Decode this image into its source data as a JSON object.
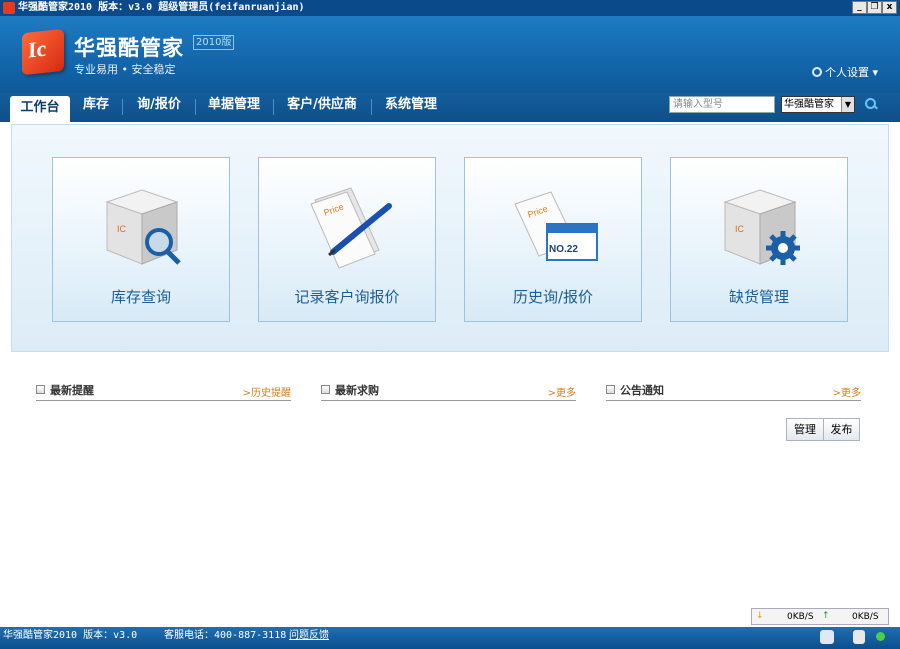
{
  "window": {
    "title": "华强酷管家2010 版本：v3.0  超级管理员(feifanruanjian)",
    "minimize": "_",
    "restore": "❐",
    "close": "x"
  },
  "brand": {
    "logo_text": "Ic",
    "name": "华强酷管家",
    "edition": "2010版",
    "slogan": "专业易用  •  安全稳定"
  },
  "header": {
    "settings_label": "个人设置 ▾"
  },
  "nav": {
    "tabs": [
      {
        "label": "工作台"
      },
      {
        "label": "库存"
      },
      {
        "label": "询/报价"
      },
      {
        "label": "单据管理"
      },
      {
        "label": "客户/供应商"
      },
      {
        "label": "系统管理"
      }
    ]
  },
  "search": {
    "placeholder": "请输入型号",
    "scope": "华强酷管家"
  },
  "tiles": [
    {
      "label": "库存查询",
      "icon": "box-search-icon"
    },
    {
      "label": "记录客户询报价",
      "icon": "price-pen-icon"
    },
    {
      "label": "历史询/报价",
      "icon": "price-calendar-icon"
    },
    {
      "label": "缺货管理",
      "icon": "box-gear-icon"
    }
  ],
  "calendar_badge": "NO.22",
  "price_tag": "Price",
  "box_tag": "IC",
  "sections": [
    {
      "title": "最新提醒",
      "more": ">历史提醒"
    },
    {
      "title": "最新求购",
      "more": ">更多"
    },
    {
      "title": "公告通知",
      "more": ">更多"
    }
  ],
  "notice_buttons": {
    "manage": "管理",
    "publish": "发布"
  },
  "network": {
    "down_arrow": "↓",
    "down_rate": "0KB/S",
    "up_arrow": "↑",
    "up_rate": "0KB/S"
  },
  "status": {
    "app": "华强酷管家2010 版本：v3.0",
    "phone": "客服电话：400-887-3118",
    "feedback": "问题反馈"
  },
  "colors": {
    "header": "#1262a6",
    "accent_orange": "#d97d1a",
    "tile_text": "#1b5f98"
  }
}
